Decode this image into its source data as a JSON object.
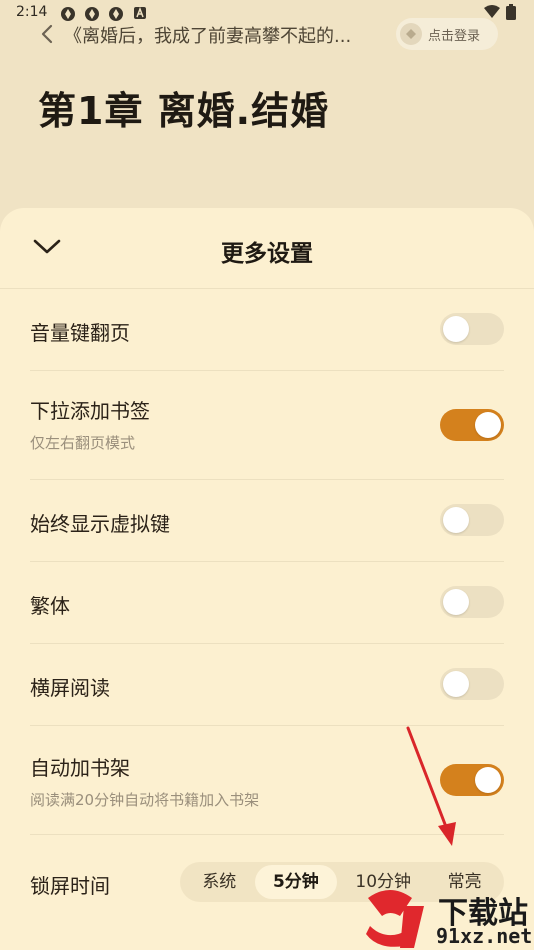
{
  "status_bar": {
    "time": "2:14",
    "left_icons": [
      "app-notification-icon",
      "app-notification-icon",
      "app-notification-icon",
      "text-notification-icon"
    ],
    "right_icons": [
      "wifi-icon",
      "battery-icon"
    ]
  },
  "reader": {
    "book_title": "《离婚后，我成了前妻高攀不起的...",
    "login_label": "点击登录",
    "chapter_title": "第1章 离婚.结婚"
  },
  "sheet": {
    "title": "更多设置",
    "settings": [
      {
        "label": "音量键翻页",
        "sub": "",
        "on": false
      },
      {
        "label": "下拉添加书签",
        "sub": "仅左右翻页模式",
        "on": true
      },
      {
        "label": "始终显示虚拟键",
        "sub": "",
        "on": false
      },
      {
        "label": "繁体",
        "sub": "",
        "on": false
      },
      {
        "label": "横屏阅读",
        "sub": "",
        "on": false
      },
      {
        "label": "自动加书架",
        "sub": "阅读满20分钟自动将书籍加入书架",
        "on": true
      }
    ],
    "lock_screen": {
      "label": "锁屏时间",
      "options": [
        "系统",
        "5分钟",
        "10分钟",
        "常亮"
      ],
      "selected": "5分钟"
    }
  },
  "watermark": {
    "text": "下载站",
    "url": "91xz.net"
  },
  "colors": {
    "accent": "#d4811d",
    "sheet_bg": "#fcf0d0",
    "page_bg": "#f0e3c4",
    "annotation_arrow": "#d9262a"
  }
}
